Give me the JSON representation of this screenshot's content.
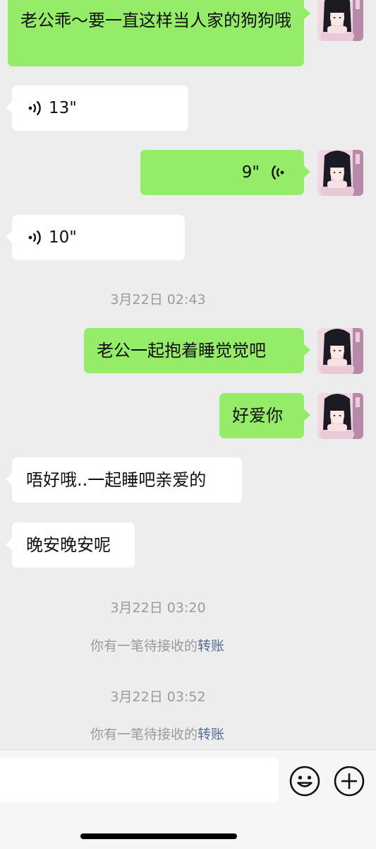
{
  "messages": [
    {
      "side": "out",
      "type": "text",
      "text": "老公乖～要一直这样当人家的狗狗哦"
    },
    {
      "side": "in",
      "type": "voice",
      "duration": "13\""
    },
    {
      "side": "out",
      "type": "voice",
      "duration": "9\""
    },
    {
      "side": "in",
      "type": "voice",
      "duration": "10\""
    },
    {
      "type": "time",
      "text": "3月22日 02:43"
    },
    {
      "side": "out",
      "type": "text",
      "text": "老公一起抱着睡觉觉吧"
    },
    {
      "side": "out",
      "type": "text",
      "text": "好爱你"
    },
    {
      "side": "in",
      "type": "text",
      "text": "唔好哦..一起睡吧亲爱的"
    },
    {
      "side": "in",
      "type": "text",
      "text": "晚安晚安呢"
    },
    {
      "type": "time",
      "text": "3月22日 03:20"
    },
    {
      "type": "system",
      "prefix": "你有一笔待接收的",
      "link": "转账"
    },
    {
      "type": "time",
      "text": "3月22日 03:52"
    },
    {
      "type": "system",
      "prefix": "你有一笔待接收的",
      "link": "转账"
    }
  ],
  "input_bar": {
    "emoji_icon": "smiley-icon",
    "plus_icon": "plus-circle-icon"
  },
  "colors": {
    "background": "#ededed",
    "outgoing_bubble": "#95ec69",
    "incoming_bubble": "#ffffff",
    "link": "#576b95",
    "timestamp": "#9a9a9a"
  }
}
